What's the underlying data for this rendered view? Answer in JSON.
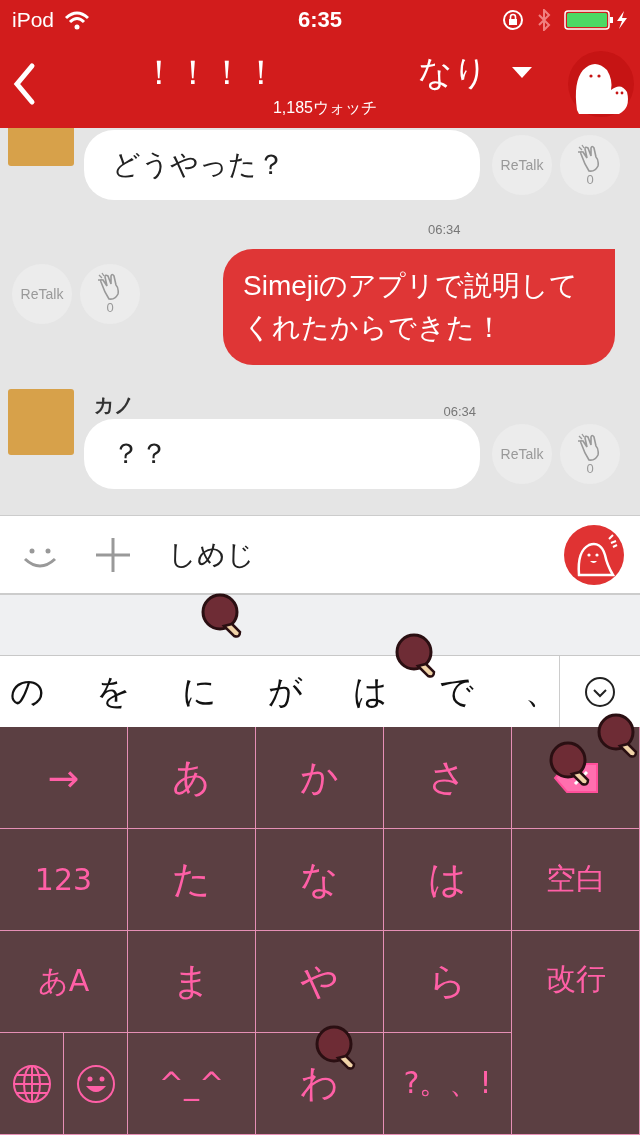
{
  "status_bar": {
    "carrier": "iPod",
    "time": "6:35"
  },
  "header": {
    "title": "！！！！",
    "user": "なり",
    "watch_count": "1,185ウォッチ"
  },
  "messages": [
    {
      "kind": "incoming",
      "text": "どうやった？",
      "retalk": "ReTalk",
      "claps": "0"
    },
    {
      "kind": "outgoing",
      "time": "06:34",
      "text": "Simejiのアプリで説明してくれたからできた！",
      "retalk": "ReTalk",
      "claps": "0"
    },
    {
      "kind": "incoming",
      "name": "カノ",
      "time": "06:34",
      "text": "？？",
      "retalk": "ReTalk",
      "claps": "0"
    }
  ],
  "input": {
    "value": "しめじ"
  },
  "candidates": [
    "の",
    "を",
    "に",
    "が",
    "は",
    "で",
    "、"
  ],
  "keyboard": {
    "keys": [
      {
        "kind": "char",
        "label": "→"
      },
      {
        "kind": "char",
        "label": "あ"
      },
      {
        "kind": "char",
        "label": "か"
      },
      {
        "kind": "char",
        "label": "さ"
      },
      {
        "kind": "delete"
      },
      {
        "kind": "char",
        "label": "123"
      },
      {
        "kind": "char",
        "label": "た"
      },
      {
        "kind": "char",
        "label": "な"
      },
      {
        "kind": "char",
        "label": "は"
      },
      {
        "kind": "char",
        "label": "空白"
      },
      {
        "kind": "char",
        "label": "あA"
      },
      {
        "kind": "char",
        "label": "ま"
      },
      {
        "kind": "char",
        "label": "や"
      },
      {
        "kind": "char",
        "label": "ら"
      },
      {
        "kind": "tall",
        "label": "改行"
      },
      {
        "kind": "globe"
      },
      {
        "kind": "emoji"
      },
      {
        "kind": "char",
        "label": "^_^"
      },
      {
        "kind": "char",
        "label": "わ"
      },
      {
        "kind": "char",
        "label": "?。、!"
      }
    ]
  }
}
